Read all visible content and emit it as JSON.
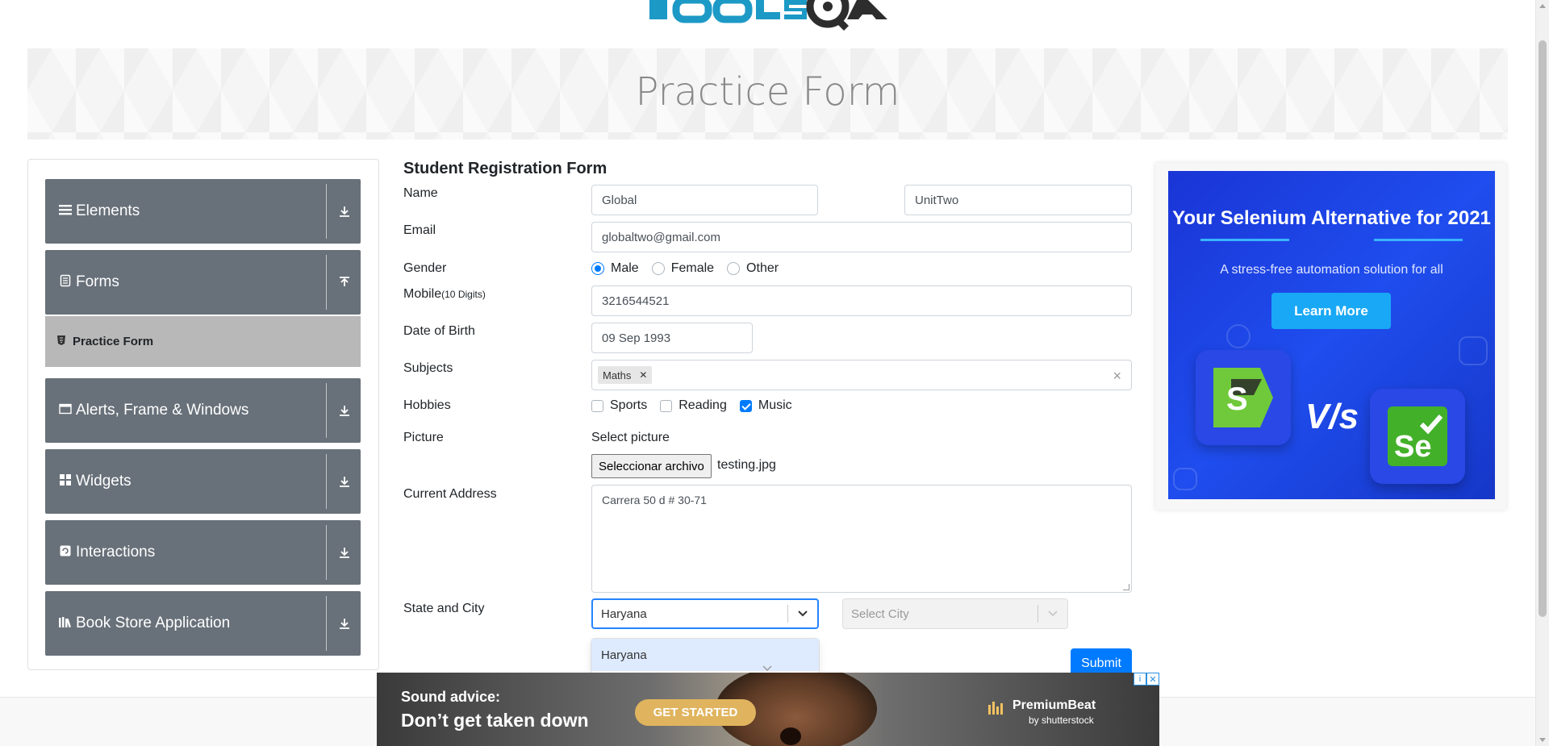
{
  "banner": {
    "title": "Practice Form"
  },
  "sidebar": {
    "groups": [
      {
        "label": "Elements",
        "icon": "menu-icon",
        "arrow": "down"
      },
      {
        "label": "Forms",
        "icon": "document-icon",
        "arrow": "up"
      },
      {
        "label": "Alerts, Frame & Windows",
        "icon": "window-icon",
        "arrow": "down"
      },
      {
        "label": "Widgets",
        "icon": "widgets-icon",
        "arrow": "down"
      },
      {
        "label": "Interactions",
        "icon": "interactions-icon",
        "arrow": "down"
      },
      {
        "label": "Book Store Application",
        "icon": "books-icon",
        "arrow": "down"
      }
    ],
    "active_item": "Practice Form"
  },
  "form": {
    "title": "Student Registration Form",
    "labels": {
      "name": "Name",
      "email": "Email",
      "gender": "Gender",
      "mobile": "Mobile",
      "mobile_hint": "(10 Digits)",
      "dob": "Date of Birth",
      "subjects": "Subjects",
      "hobbies": "Hobbies",
      "picture": "Picture",
      "address": "Current Address",
      "state_city": "State and City"
    },
    "first_name": "Global",
    "last_name": "UnitTwo",
    "email": "globaltwo@gmail.com",
    "gender_options": [
      "Male",
      "Female",
      "Other"
    ],
    "gender_selected": "Male",
    "mobile": "3216544521",
    "dob": "09 Sep 1993",
    "subjects": [
      "Maths"
    ],
    "hobbies": [
      {
        "label": "Sports",
        "checked": false
      },
      {
        "label": "Reading",
        "checked": false
      },
      {
        "label": "Music",
        "checked": true
      }
    ],
    "picture_caption": "Select picture",
    "file_button": "Seleccionar archivo",
    "file_name": "testing.jpg",
    "address": "Carrera 50 d # 30-71",
    "state_value": "Haryana",
    "city_placeholder": "Select City",
    "state_options": [
      "Haryana"
    ],
    "submit_label": "Submit"
  },
  "ad_right": {
    "title": "Your Selenium Alternative for 2021",
    "subtitle": "A stress-free automation solution for all",
    "button": "Learn More",
    "versus": "V/s"
  },
  "ad_bottom": {
    "line1": "Sound advice:",
    "line2": "Don’t get taken down",
    "button": "GET STARTED",
    "brand": "PremiumBeat",
    "brand_sub": "by shutterstock"
  },
  "colors": {
    "accent": "#007bff",
    "sidebar_bg": "#687079",
    "sidebar_active": "#b8b8b8",
    "logo_blue": "#1d99c6"
  }
}
